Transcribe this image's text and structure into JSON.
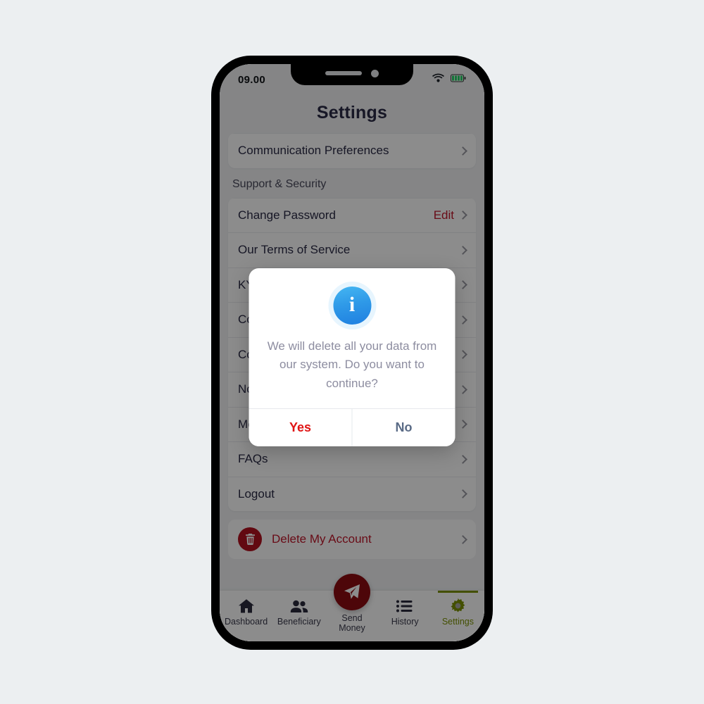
{
  "status_bar": {
    "time": "09.00",
    "wifi_icon": "wifi-icon",
    "battery_icon": "battery-full-icon"
  },
  "header": {
    "title": "Settings"
  },
  "settings": {
    "top_card_rows": [
      {
        "label": "Communication Preferences",
        "chevron": "chevron-right-icon"
      }
    ],
    "section_title": "Support & Security",
    "support_rows": [
      {
        "label": "Change Password",
        "action": "Edit",
        "chevron": "chevron-right-icon"
      },
      {
        "label": "Our Terms of Service",
        "action": "",
        "chevron": "chevron-right-icon"
      },
      {
        "label": "KYC Verification",
        "action": "",
        "chevron": "chevron-right-icon"
      },
      {
        "label": "Contact Us",
        "action": "",
        "chevron": "chevron-right-icon"
      },
      {
        "label": "Compliance",
        "action": "",
        "chevron": "chevron-right-icon"
      },
      {
        "label": "Notifications",
        "action": "",
        "chevron": "chevron-right-icon"
      },
      {
        "label": "More Information",
        "action": "",
        "chevron": "chevron-right-icon"
      },
      {
        "label": "FAQs",
        "action": "",
        "chevron": "chevron-right-icon"
      },
      {
        "label": "Logout",
        "action": "",
        "chevron": "chevron-right-icon"
      }
    ],
    "delete_account": {
      "icon": "trash-icon",
      "label": "Delete My Account",
      "chevron": "chevron-right-icon",
      "color": "#c0162a"
    }
  },
  "dialog": {
    "icon": "info-circle-icon",
    "message": "We will delete all your data from our system. Do you want to continue?",
    "confirm_label": "Yes",
    "dismiss_label": "No",
    "confirm_color": "#e01414",
    "dismiss_color": "#5a6b86"
  },
  "bottom_nav": {
    "active_color": "#7a9100",
    "items": [
      {
        "label": "Dashboard",
        "icon": "home-icon",
        "active": false
      },
      {
        "label": "Beneficiary",
        "icon": "people-icon",
        "active": false
      },
      {
        "label": "Send\nMoney",
        "icon": "send-paper-plane-icon",
        "active": false
      },
      {
        "label": "History",
        "icon": "list-icon",
        "active": false
      },
      {
        "label": "Settings",
        "icon": "gear-icon",
        "active": true
      }
    ],
    "send_money_label_line1": "Send",
    "send_money_label_line2": "Money"
  }
}
